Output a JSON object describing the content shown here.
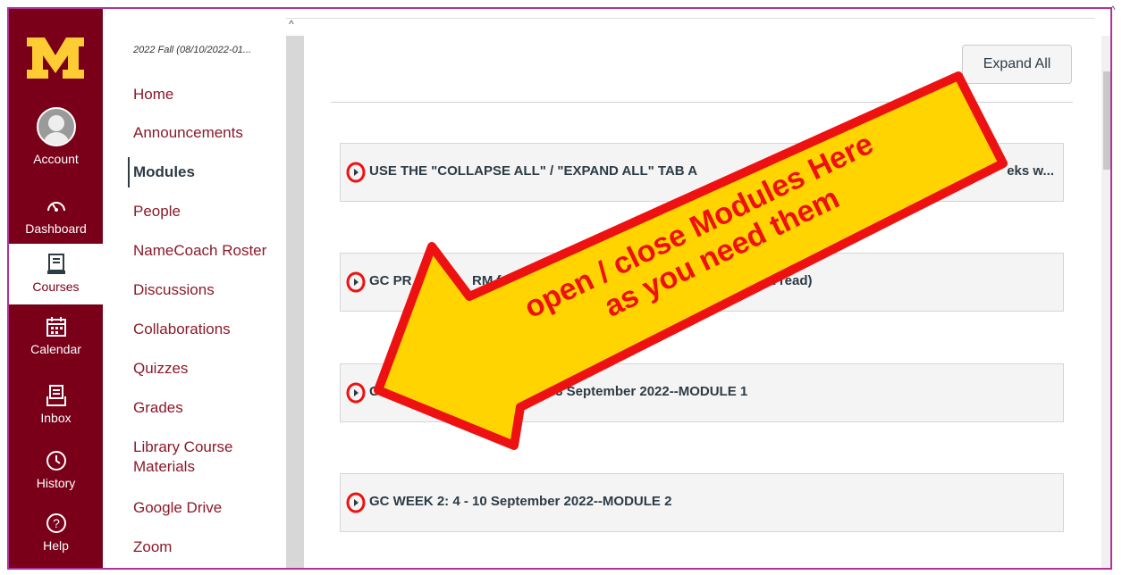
{
  "global_nav": {
    "account": "Account",
    "dashboard": "Dashboard",
    "courses": "Courses",
    "calendar": "Calendar",
    "inbox": "Inbox",
    "history": "History",
    "help": "Help",
    "brand_color": "#7a0019",
    "accent_color": "#ffcc33"
  },
  "course_nav": {
    "term": "2022 Fall (08/10/2022-01...",
    "items": [
      {
        "label": "Home"
      },
      {
        "label": "Announcements"
      },
      {
        "label": "Modules",
        "active": true
      },
      {
        "label": "People"
      },
      {
        "label": "NameCoach Roster"
      },
      {
        "label": "Discussions"
      },
      {
        "label": "Collaborations"
      },
      {
        "label": "Quizzes"
      },
      {
        "label": "Grades"
      },
      {
        "label": "Library Course\nMaterials"
      },
      {
        "label": "Google Drive"
      },
      {
        "label": "Zoom"
      }
    ]
  },
  "content": {
    "expand_all": "Expand All",
    "modules": [
      {
        "title": "USE THE \"COLLAPSE ALL\" / \"EXPAND ALL\" TAB A",
        "title_end": "eks w..."
      },
      {
        "title": "GC PR",
        "title_mid": "RM f",
        "title_end": ", but read)"
      },
      {
        "title": "GC",
        "title_end": "ugust - 3 September 2022--MODULE 1"
      },
      {
        "title": "GC WEEK 2: 4 - 10 September 2022--MODULE 2"
      }
    ]
  },
  "annotation": {
    "line1": "open / close Modules Here",
    "line2": "as you need them",
    "fill_color": "#ffd400",
    "stroke_color": "#ee1111"
  }
}
